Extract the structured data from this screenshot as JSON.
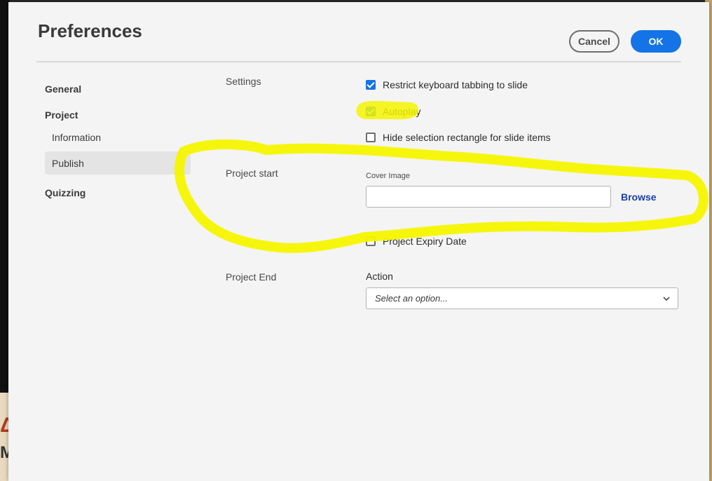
{
  "dialog": {
    "title": "Preferences",
    "cancel_label": "Cancel",
    "ok_label": "OK"
  },
  "sidebar": {
    "general": "General",
    "project": "Project",
    "information": "Information",
    "publish": "Publish",
    "quizzing": "Quizzing",
    "selected": "Publish"
  },
  "content": {
    "settings_label": "Settings",
    "restrict_tabbing": {
      "label": "Restrict keyboard tabbing to slide",
      "checked": true
    },
    "autoplay": {
      "label": "Autoplay",
      "checked": true
    },
    "hide_selection": {
      "label": "Hide selection rectangle for slide items",
      "checked": false
    },
    "project_start_label": "Project start",
    "cover_image_label": "Cover Image",
    "cover_image_value": "",
    "browse_label": "Browse",
    "expiry": {
      "label": "Project Expiry Date",
      "checked": false
    },
    "project_end_label": "Project End",
    "action_label": "Action",
    "action_select_placeholder": "Select an option..."
  },
  "colors": {
    "accent": "#1473e6",
    "annotation_highlight": "#f5f500",
    "link": "#1a3fa8"
  },
  "icons": {
    "checkbox_checked": "checkmark-icon",
    "select_chevron": "chevron-down-icon"
  }
}
